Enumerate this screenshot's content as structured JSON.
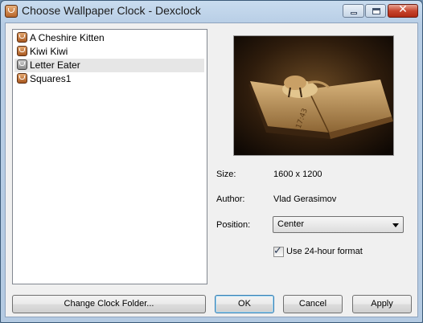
{
  "window": {
    "title": "Choose Wallpaper Clock - Dexclock"
  },
  "titlebar": {
    "min_symbol": "",
    "max_symbol": "",
    "close_symbol": "✕"
  },
  "list": {
    "items": [
      {
        "label": "A Cheshire Kitten",
        "selected": false
      },
      {
        "label": "Kiwi Kiwi",
        "selected": false
      },
      {
        "label": "Letter Eater",
        "selected": true
      },
      {
        "label": "Squares1",
        "selected": false
      }
    ]
  },
  "preview": {
    "clock_text": "17:43"
  },
  "details": {
    "size_label": "Size:",
    "size_value": "1600 x 1200",
    "author_label": "Author:",
    "author_value": "Vlad Gerasimov",
    "position_label": "Position:",
    "position_value": "Center",
    "checkbox_label": "Use 24-hour format",
    "checkbox_checked": true,
    "checkmark": "✓"
  },
  "buttons": {
    "change_folder": "Change Clock Folder...",
    "ok": "OK",
    "cancel": "Cancel",
    "apply": "Apply"
  },
  "colors": {
    "title_bar": "#c9dcef",
    "selection": "#e6e6e6",
    "default_button_border": "#3c7fb1"
  },
  "icons": [
    "app-icon",
    "clock-item-icon",
    "dropdown-arrow-icon",
    "minimize-icon",
    "maximize-icon",
    "close-icon"
  ]
}
